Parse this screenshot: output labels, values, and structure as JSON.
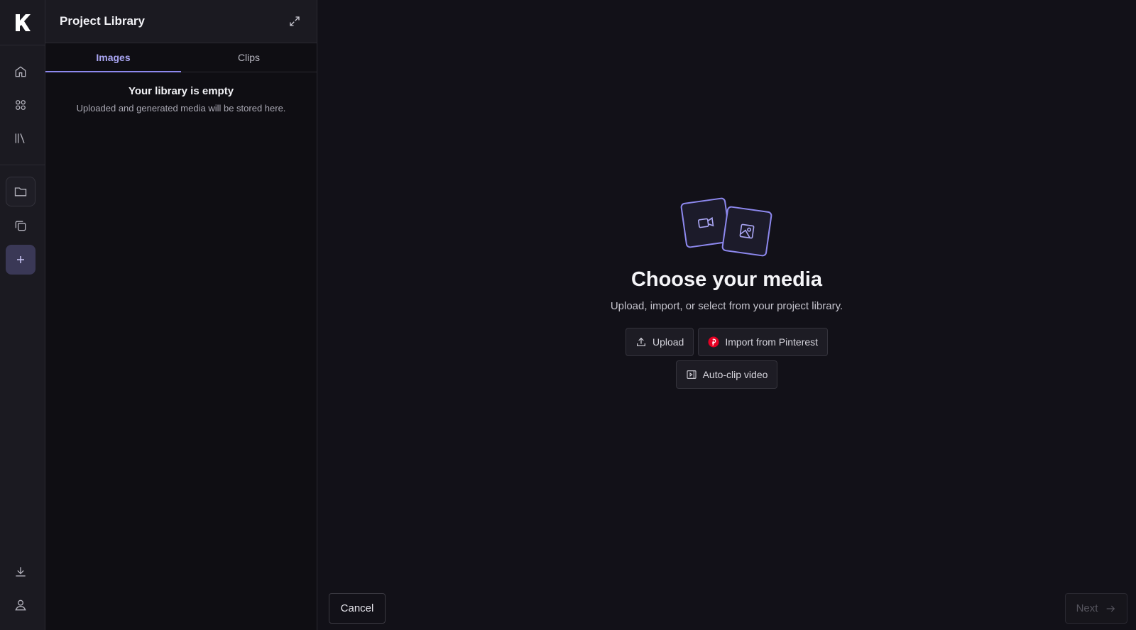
{
  "app": {
    "logo": "K"
  },
  "rail": {
    "items": [
      {
        "icon": "home-icon"
      },
      {
        "icon": "grid-icon"
      },
      {
        "icon": "library-icon"
      },
      {
        "icon": "folder-icon"
      },
      {
        "icon": "copy-icon"
      },
      {
        "icon": "plus-icon"
      }
    ],
    "bottom": [
      {
        "icon": "download-icon"
      },
      {
        "icon": "user-icon"
      }
    ]
  },
  "library": {
    "title": "Project Library",
    "tabs": [
      {
        "label": "Images",
        "active": true
      },
      {
        "label": "Clips",
        "active": false
      }
    ],
    "empty_title": "Your library is empty",
    "empty_subtitle": "Uploaded and generated media will be stored here."
  },
  "main": {
    "headline": "Choose your media",
    "subline": "Upload, import, or select from your project library.",
    "upload_label": "Upload",
    "pinterest_label": "Import from Pinterest",
    "autoclip_label": "Auto-clip video",
    "cancel_label": "Cancel",
    "next_label": "Next"
  },
  "colors": {
    "accent": "#8d88ee",
    "background": "#121118",
    "pinterest": "#e60023"
  }
}
